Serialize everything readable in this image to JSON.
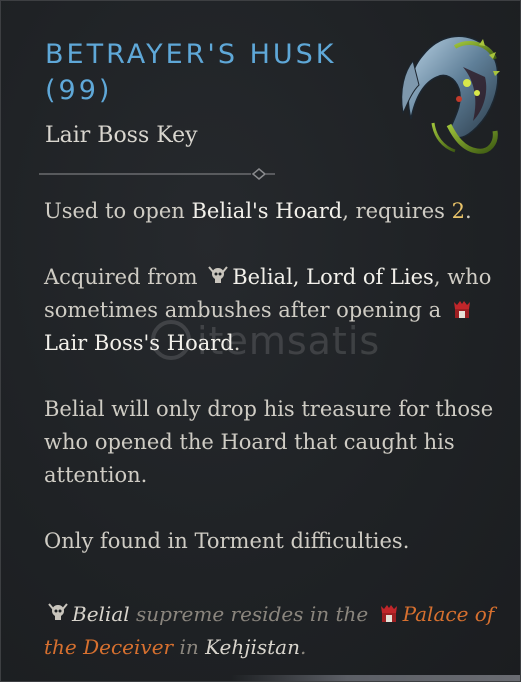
{
  "item": {
    "title_line1": "BETRAYER'S HUSK",
    "title_line2": "(99)",
    "type": "Lair Boss Key",
    "icon": "betrayers-husk-icon"
  },
  "description": {
    "p1": {
      "text1": "Used to open ",
      "hoard_name": "Belial's Hoard",
      "text2": ", requires ",
      "count": "2",
      "text3": "."
    },
    "p2": {
      "text1": "Acquired from ",
      "boss_name": "Belial, Lord of Lies",
      "text2": ", who sometimes ambushes after opening a ",
      "hoard_type": "Lair Boss's Hoard",
      "text3": "."
    },
    "p3": "Belial will only drop his treasure for those who opened the Hoard that caught his attention.",
    "p4": "Only found in Torment difficulties."
  },
  "flavor": {
    "boss": "Belial",
    "text1": " supreme resides in the ",
    "location": "Palace of the Deceiver",
    "text2": " in ",
    "region": "Kehjistan",
    "text3": "."
  },
  "watermark": {
    "text": "itemsatis"
  },
  "colors": {
    "title": "#5fa8d8",
    "gold_value": "#e8c36a",
    "location_orange": "#d7702f",
    "body_text": "#cfccc4",
    "background": "#1e2124"
  }
}
